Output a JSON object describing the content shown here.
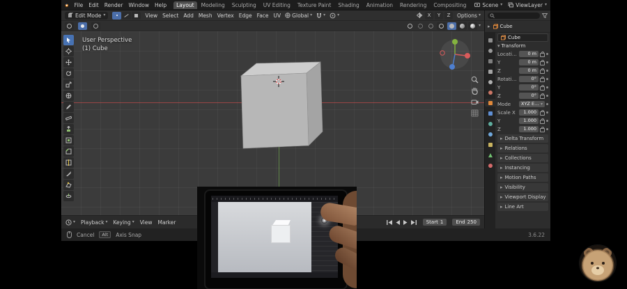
{
  "topbar": {
    "menus": [
      "File",
      "Edit",
      "Render",
      "Window",
      "Help"
    ],
    "workspaces": [
      "Layout",
      "Modeling",
      "Sculpting",
      "UV Editing",
      "Texture Paint",
      "Shading",
      "Animation",
      "Rendering",
      "Compositing"
    ],
    "active_workspace": "Layout",
    "scene_label": "Scene",
    "viewlayer_label": "ViewLayer"
  },
  "viewport_header": {
    "mode": "Edit Mode",
    "menus": [
      "View",
      "Select",
      "Add",
      "Mesh",
      "Vertex",
      "Edge",
      "Face",
      "UV"
    ],
    "orientation": "Global",
    "mirror_axes": [
      "X",
      "Y",
      "Z"
    ],
    "options_label": "Options"
  },
  "viewport": {
    "perspective_label": "User Perspective",
    "object_label": "(1) Cube"
  },
  "timeline": {
    "menus": [
      "Playback",
      "Keying",
      "View",
      "Marker"
    ],
    "start_label": "Start",
    "start_value": "1",
    "end_label": "End",
    "end_value": "250"
  },
  "statusbar": {
    "cancel_label": "Cancel",
    "alt_key": "Alt",
    "alt_action": "Axis Snap",
    "version": "3.6.22"
  },
  "outliner": {
    "item": "Cube"
  },
  "properties": {
    "object_name": "Cube",
    "transform_label": "Transform",
    "transform_rows": [
      {
        "label": "Location X",
        "value": "0 m"
      },
      {
        "label": "Y",
        "value": "0 m"
      },
      {
        "label": "Z",
        "value": "0 m"
      },
      {
        "label": "Rotation X",
        "value": "0°"
      },
      {
        "label": "Y",
        "value": "0°"
      },
      {
        "label": "Z",
        "value": "0°"
      }
    ],
    "mode_label": "Mode",
    "mode_value": "XYZ Euler",
    "scale_rows": [
      {
        "label": "Scale X",
        "value": "1.000"
      },
      {
        "label": "Y",
        "value": "1.000"
      },
      {
        "label": "Z",
        "value": "1.000"
      }
    ],
    "panels": [
      "Delta Transform",
      "Relations",
      "Collections",
      "Instancing",
      "Motion Paths",
      "Visibility",
      "Viewport Display",
      "Line Art"
    ]
  },
  "icons": {
    "chevron_down": "▾",
    "caret_right": "▸",
    "caret_down": "▾"
  },
  "colors": {
    "accent": "#4772b3",
    "object_orange": "#e0883a",
    "axis_x": "#d95b5b",
    "axis_y": "#84b33f",
    "axis_z": "#4e7fd0"
  }
}
